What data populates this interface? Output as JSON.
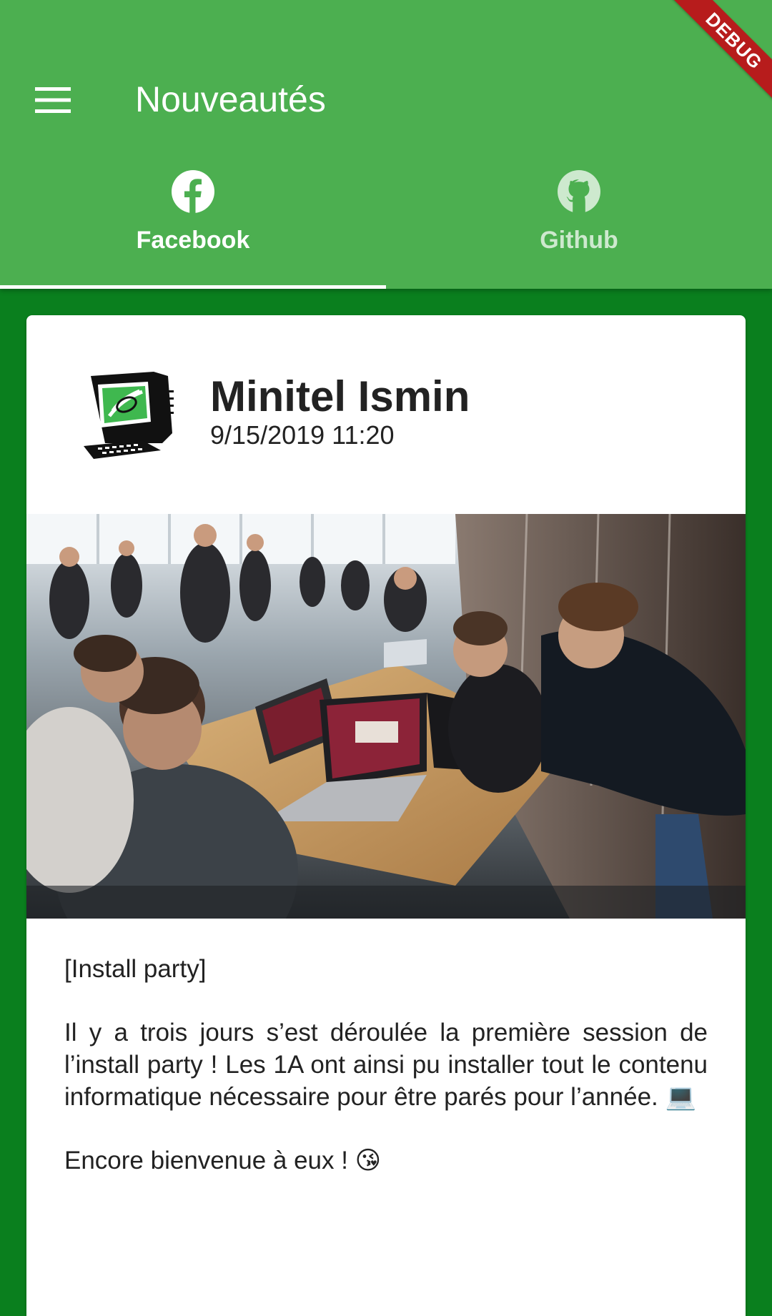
{
  "appbar": {
    "title": "Nouveautés",
    "debug_banner": "DEBUG",
    "background_color": "#4caf50",
    "menu_icon": "hamburger-menu-icon"
  },
  "tabs": [
    {
      "label": "Facebook",
      "icon": "facebook-icon",
      "selected": true
    },
    {
      "label": "Github",
      "icon": "github-icon",
      "selected": false
    }
  ],
  "post": {
    "author": "Minitel Ismin",
    "date": "9/15/2019 11:20",
    "image": "photo of students with laptops at install party",
    "paragraphs": [
      "[Install party]",
      "Il y a trois jours s’est déroulée la première session de l’install party ! Les 1A ont ainsi pu installer tout le contenu informatique nécessaire pour être parés pour l’année. 💻",
      "Encore bienvenue à eux ! 😘"
    ]
  },
  "colors": {
    "page_background": "#0a7f1e",
    "appbar": "#4caf50",
    "debug_ribbon": "#b71c1c"
  }
}
